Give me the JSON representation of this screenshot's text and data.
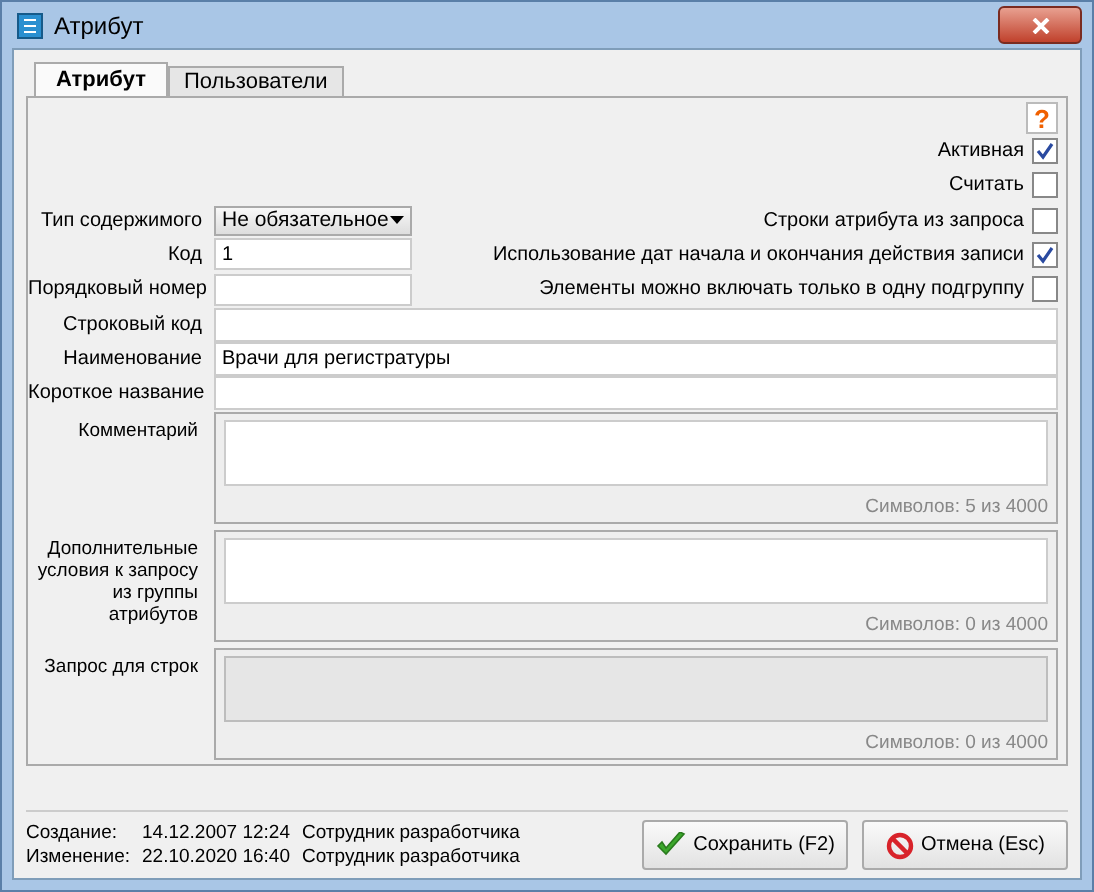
{
  "window": {
    "title": "Атрибут"
  },
  "tabs": [
    {
      "label": "Атрибут",
      "selected": true
    },
    {
      "label": "Пользователи",
      "selected": false
    }
  ],
  "help": "?",
  "rows": [
    {
      "field": null,
      "checkbox": {
        "label": "Активная",
        "checked": true
      }
    },
    {
      "field": null,
      "checkbox": {
        "label": "Считать",
        "checked": false
      }
    },
    {
      "field": {
        "label": "Тип содержимого",
        "kind": "select",
        "value": "Не обязательное"
      },
      "checkbox": {
        "label": "Строки атрибута из запроса",
        "checked": false
      }
    },
    {
      "field": {
        "label": "Код",
        "kind": "text",
        "value": "1"
      },
      "checkbox": {
        "label": "Использование дат начала и окончания действия записи",
        "checked": true
      }
    },
    {
      "field": {
        "label": "Порядковый номер",
        "kind": "text"
      },
      "checkbox": {
        "label": "Элементы можно включать только в одну подгруппу",
        "checked": false
      }
    }
  ],
  "wide_fields": [
    {
      "label": "Строковый код"
    },
    {
      "label": "Наименование",
      "value": "Врачи для регистратуры"
    },
    {
      "label": "Короткое название"
    }
  ],
  "memos": [
    {
      "label": "Комментарий",
      "counter": "Символов: 5 из 4000",
      "disabled": false
    },
    {
      "label": "Дополнительные условия к запросу из группы атрибутов",
      "counter": "Символов: 0 из 4000",
      "disabled": false
    },
    {
      "label": "Запрос для строк",
      "counter": "Символов: 0 из 4000",
      "disabled": true
    }
  ],
  "audit": [
    {
      "label": "Создание:",
      "date": "14.12.2007 12:24",
      "user": "Сотрудник разработчика"
    },
    {
      "label": "Изменение:",
      "date": "22.10.2020 16:40",
      "user": "Сотрудник разработчика"
    }
  ],
  "buttons": [
    {
      "kind": "save",
      "label": "Сохранить (F2)"
    },
    {
      "kind": "cancel",
      "label": "Отмена (Esc)"
    }
  ]
}
